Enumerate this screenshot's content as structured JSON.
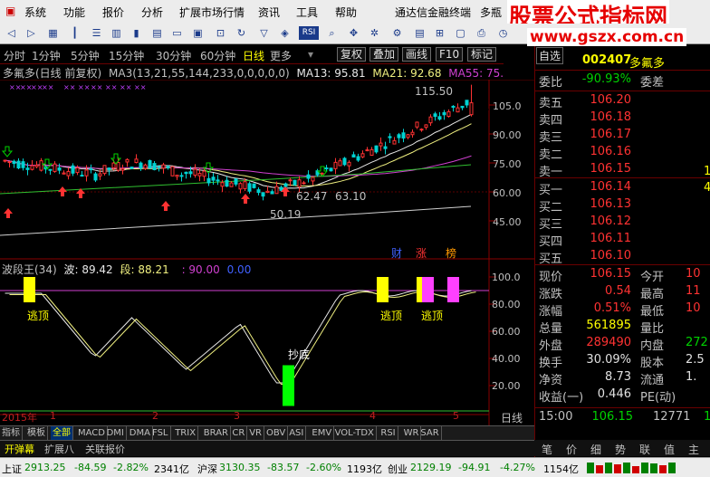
{
  "menu": [
    "系统",
    "功能",
    "报价",
    "分析",
    "扩展市场行情",
    "资讯",
    "工具",
    "帮助"
  ],
  "app_title": "通达信金融终端",
  "app_title_suffix": "多瓶",
  "watermark": {
    "line1": "股票公式指标网",
    "line2": "www.gszx.com.cn"
  },
  "toolbar_icons": [
    "back-icon",
    "forward-icon",
    "chart-grid-icon",
    "candlestick-icon",
    "list-icon",
    "kline-icon",
    "refresh-icon",
    "analysis-icon",
    "rsi-icon",
    "nav-arrows-icon",
    "settings-icon",
    "table-icon",
    "ext-icon"
  ],
  "periods": [
    "分时",
    "1分钟",
    "5分钟",
    "15分钟",
    "30分钟",
    "60分钟",
    "日线",
    "更多"
  ],
  "active_period": "日线",
  "period_buttons": [
    "复权",
    "叠加",
    "画线",
    "F10",
    "标记"
  ],
  "right_header": {
    "right_tag": "自选",
    "code": "002407",
    "name": "多氟多"
  },
  "chart": {
    "stock_title": "多氟多(日线 前复权)",
    "ma_label": "MA3(13,21,55,144,233,0,0,0,0,0)",
    "ma13": "MA13: 95.81",
    "ma21": "MA21: 92.68",
    "ma55": "MA55: 75.",
    "y_ticks": [
      "105.0",
      "90.00",
      "75.00",
      "60.00",
      "45.00"
    ],
    "annotations": {
      "high": "115.50",
      "mid_left": "62.47",
      "mid_right": "63.10",
      "low": "50.19"
    },
    "tags": [
      "财",
      "涨",
      "榜"
    ]
  },
  "indicator": {
    "name": "波段王(34)",
    "bo": "波: 89.42",
    "duan": "段: 88.21",
    "ref": ": 90.00",
    "ref2": "0.00",
    "y_ticks": [
      "100.0",
      "80.00",
      "60.00",
      "40.00",
      "20.00"
    ],
    "labels": {
      "escape1": "逃顶",
      "escape2": "逃顶",
      "escape3": "逃顶",
      "bottom": "抄底"
    },
    "x_ticks": [
      "2015年",
      "1",
      "2",
      "3",
      "4",
      "5"
    ],
    "period_right": "日线"
  },
  "quote": {
    "weibi_label": "委比",
    "weibi_val": "-90.93%",
    "weicha_label": "委差",
    "asks": [
      {
        "l": "卖五",
        "p": "106.20"
      },
      {
        "l": "卖四",
        "p": "106.18"
      },
      {
        "l": "卖三",
        "p": "106.17"
      },
      {
        "l": "卖二",
        "p": "106.16"
      },
      {
        "l": "卖一",
        "p": "106.15"
      }
    ],
    "bids": [
      {
        "l": "买一",
        "p": "106.14"
      },
      {
        "l": "买二",
        "p": "106.13"
      },
      {
        "l": "买三",
        "p": "106.12"
      },
      {
        "l": "买四",
        "p": "106.11"
      },
      {
        "l": "买五",
        "p": "106.10"
      }
    ],
    "stats": [
      {
        "a": "现价",
        "b": "106.15",
        "c": "今开",
        "d": "10"
      },
      {
        "a": "涨跌",
        "b": "0.54",
        "c": "最高",
        "d": "11"
      },
      {
        "a": "涨幅",
        "b": "0.51%",
        "c": "最低",
        "d": "10"
      },
      {
        "a": "总量",
        "b": "561895",
        "c": "量比",
        "d": ""
      },
      {
        "a": "外盘",
        "b": "289490",
        "c": "内盘",
        "d": "272"
      },
      {
        "a": "换手",
        "b": "30.09%",
        "c": "股本",
        "d": "2.5"
      },
      {
        "a": "净资",
        "b": "8.73",
        "c": "流通",
        "d": "1."
      },
      {
        "a": "收益(一)",
        "b": "0.446",
        "c": "PE(动)",
        "d": ""
      }
    ],
    "tick": {
      "time": "15:00",
      "price": "106.15",
      "vol": "12771",
      "flag": "1"
    },
    "right_digits": [
      "1",
      "4"
    ]
  },
  "indicator_tabs": [
    "指标",
    "模板",
    "全部",
    "MACD",
    "DMI",
    "DMA",
    "FSL",
    "TRIX",
    "BRAR",
    "CR",
    "VR",
    "OBV",
    "ASI",
    "EMV",
    "VOL-TDX",
    "RSI",
    "WR",
    "SAR"
  ],
  "active_indicator_tab": "全部",
  "bottom_tabs": [
    "开弹幕",
    "扩展八",
    "关联报价"
  ],
  "right_tabs": [
    "笔",
    "价",
    "细",
    "势",
    "联",
    "值",
    "主"
  ],
  "status": {
    "sh_label": "上证",
    "sh_val": "2913.25",
    "sh_chg": "-84.59",
    "sh_pct": "-2.82%",
    "sh_amt": "2341亿",
    "sz_label": "沪深",
    "sz_val": "3130.35",
    "sz_chg": "-83.57",
    "sz_pct": "-2.60%",
    "sz_amt": "1193亿",
    "cy_label": "创业",
    "cy_val": "2129.19",
    "cy_chg": "-94.91",
    "cy_pct": "-4.27%",
    "cy_amt": "1154亿"
  },
  "colors": {
    "up": "#ff3232",
    "down": "#00d200",
    "ma_white": "#e8e8e8",
    "ma_yellow": "#f0f080",
    "ma_magenta": "#d040d0",
    "ma_green": "#30c030"
  }
}
